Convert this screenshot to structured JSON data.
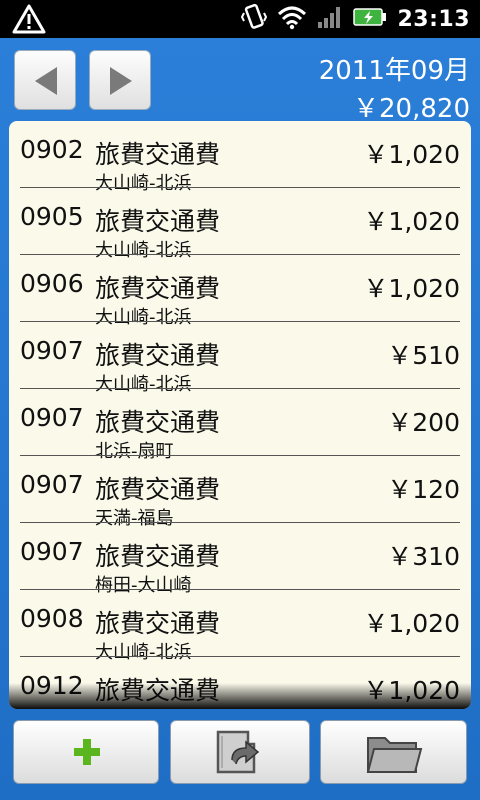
{
  "status_bar": {
    "time": "23:13",
    "icons": [
      "warning-icon",
      "vibrate-icon",
      "wifi-icon",
      "signal-icon",
      "battery-charging-icon"
    ]
  },
  "header": {
    "month": "2011年09月",
    "total": "￥20,820",
    "prev_icon": "arrow-left-icon",
    "next_icon": "arrow-right-icon"
  },
  "entries": [
    {
      "date": "0902",
      "category": "旅費交通費",
      "amount": "￥1,020",
      "memo": "大山崎-北浜"
    },
    {
      "date": "0905",
      "category": "旅費交通費",
      "amount": "￥1,020",
      "memo": "大山崎-北浜"
    },
    {
      "date": "0906",
      "category": "旅費交通費",
      "amount": "￥1,020",
      "memo": "大山崎-北浜"
    },
    {
      "date": "0907",
      "category": "旅費交通費",
      "amount": "￥510",
      "memo": "大山崎-北浜"
    },
    {
      "date": "0907",
      "category": "旅費交通費",
      "amount": "￥200",
      "memo": "北浜-扇町"
    },
    {
      "date": "0907",
      "category": "旅費交通費",
      "amount": "￥120",
      "memo": "天満-福島"
    },
    {
      "date": "0907",
      "category": "旅費交通費",
      "amount": "￥310",
      "memo": "梅田-大山崎"
    },
    {
      "date": "0908",
      "category": "旅費交通費",
      "amount": "￥1,020",
      "memo": "大山崎-北浜"
    },
    {
      "date": "0912",
      "category": "旅費交通費",
      "amount": "￥1,020",
      "memo": ""
    }
  ],
  "toolbar": {
    "add_icon": "plus-icon",
    "sync_icon": "refresh-document-icon",
    "open_icon": "folder-icon"
  },
  "colors": {
    "background": "#1f6ec6",
    "list_background": "#fbf9ea",
    "add_icon": "#5bb51e"
  }
}
